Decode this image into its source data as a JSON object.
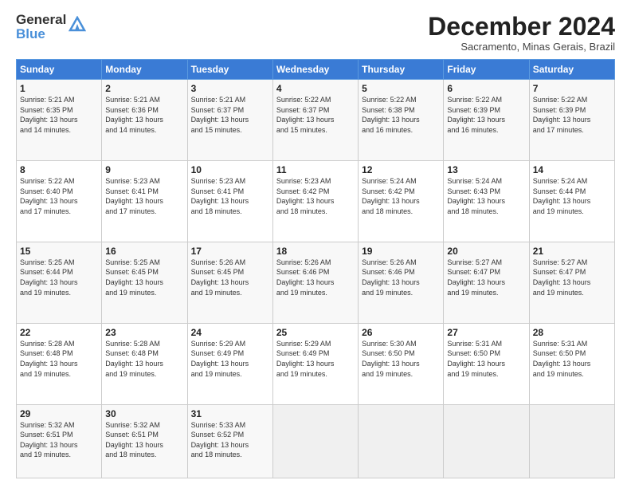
{
  "header": {
    "logo_line1": "General",
    "logo_line2": "Blue",
    "month_title": "December 2024",
    "subtitle": "Sacramento, Minas Gerais, Brazil"
  },
  "weekdays": [
    "Sunday",
    "Monday",
    "Tuesday",
    "Wednesday",
    "Thursday",
    "Friday",
    "Saturday"
  ],
  "weeks": [
    [
      {
        "day": "1",
        "info": "Sunrise: 5:21 AM\nSunset: 6:35 PM\nDaylight: 13 hours\nand 14 minutes."
      },
      {
        "day": "2",
        "info": "Sunrise: 5:21 AM\nSunset: 6:36 PM\nDaylight: 13 hours\nand 14 minutes."
      },
      {
        "day": "3",
        "info": "Sunrise: 5:21 AM\nSunset: 6:37 PM\nDaylight: 13 hours\nand 15 minutes."
      },
      {
        "day": "4",
        "info": "Sunrise: 5:22 AM\nSunset: 6:37 PM\nDaylight: 13 hours\nand 15 minutes."
      },
      {
        "day": "5",
        "info": "Sunrise: 5:22 AM\nSunset: 6:38 PM\nDaylight: 13 hours\nand 16 minutes."
      },
      {
        "day": "6",
        "info": "Sunrise: 5:22 AM\nSunset: 6:39 PM\nDaylight: 13 hours\nand 16 minutes."
      },
      {
        "day": "7",
        "info": "Sunrise: 5:22 AM\nSunset: 6:39 PM\nDaylight: 13 hours\nand 17 minutes."
      }
    ],
    [
      {
        "day": "8",
        "info": "Sunrise: 5:22 AM\nSunset: 6:40 PM\nDaylight: 13 hours\nand 17 minutes."
      },
      {
        "day": "9",
        "info": "Sunrise: 5:23 AM\nSunset: 6:41 PM\nDaylight: 13 hours\nand 17 minutes."
      },
      {
        "day": "10",
        "info": "Sunrise: 5:23 AM\nSunset: 6:41 PM\nDaylight: 13 hours\nand 18 minutes."
      },
      {
        "day": "11",
        "info": "Sunrise: 5:23 AM\nSunset: 6:42 PM\nDaylight: 13 hours\nand 18 minutes."
      },
      {
        "day": "12",
        "info": "Sunrise: 5:24 AM\nSunset: 6:42 PM\nDaylight: 13 hours\nand 18 minutes."
      },
      {
        "day": "13",
        "info": "Sunrise: 5:24 AM\nSunset: 6:43 PM\nDaylight: 13 hours\nand 18 minutes."
      },
      {
        "day": "14",
        "info": "Sunrise: 5:24 AM\nSunset: 6:44 PM\nDaylight: 13 hours\nand 19 minutes."
      }
    ],
    [
      {
        "day": "15",
        "info": "Sunrise: 5:25 AM\nSunset: 6:44 PM\nDaylight: 13 hours\nand 19 minutes."
      },
      {
        "day": "16",
        "info": "Sunrise: 5:25 AM\nSunset: 6:45 PM\nDaylight: 13 hours\nand 19 minutes."
      },
      {
        "day": "17",
        "info": "Sunrise: 5:26 AM\nSunset: 6:45 PM\nDaylight: 13 hours\nand 19 minutes."
      },
      {
        "day": "18",
        "info": "Sunrise: 5:26 AM\nSunset: 6:46 PM\nDaylight: 13 hours\nand 19 minutes."
      },
      {
        "day": "19",
        "info": "Sunrise: 5:26 AM\nSunset: 6:46 PM\nDaylight: 13 hours\nand 19 minutes."
      },
      {
        "day": "20",
        "info": "Sunrise: 5:27 AM\nSunset: 6:47 PM\nDaylight: 13 hours\nand 19 minutes."
      },
      {
        "day": "21",
        "info": "Sunrise: 5:27 AM\nSunset: 6:47 PM\nDaylight: 13 hours\nand 19 minutes."
      }
    ],
    [
      {
        "day": "22",
        "info": "Sunrise: 5:28 AM\nSunset: 6:48 PM\nDaylight: 13 hours\nand 19 minutes."
      },
      {
        "day": "23",
        "info": "Sunrise: 5:28 AM\nSunset: 6:48 PM\nDaylight: 13 hours\nand 19 minutes."
      },
      {
        "day": "24",
        "info": "Sunrise: 5:29 AM\nSunset: 6:49 PM\nDaylight: 13 hours\nand 19 minutes."
      },
      {
        "day": "25",
        "info": "Sunrise: 5:29 AM\nSunset: 6:49 PM\nDaylight: 13 hours\nand 19 minutes."
      },
      {
        "day": "26",
        "info": "Sunrise: 5:30 AM\nSunset: 6:50 PM\nDaylight: 13 hours\nand 19 minutes."
      },
      {
        "day": "27",
        "info": "Sunrise: 5:31 AM\nSunset: 6:50 PM\nDaylight: 13 hours\nand 19 minutes."
      },
      {
        "day": "28",
        "info": "Sunrise: 5:31 AM\nSunset: 6:50 PM\nDaylight: 13 hours\nand 19 minutes."
      }
    ],
    [
      {
        "day": "29",
        "info": "Sunrise: 5:32 AM\nSunset: 6:51 PM\nDaylight: 13 hours\nand 19 minutes."
      },
      {
        "day": "30",
        "info": "Sunrise: 5:32 AM\nSunset: 6:51 PM\nDaylight: 13 hours\nand 18 minutes."
      },
      {
        "day": "31",
        "info": "Sunrise: 5:33 AM\nSunset: 6:52 PM\nDaylight: 13 hours\nand 18 minutes."
      },
      null,
      null,
      null,
      null
    ]
  ]
}
